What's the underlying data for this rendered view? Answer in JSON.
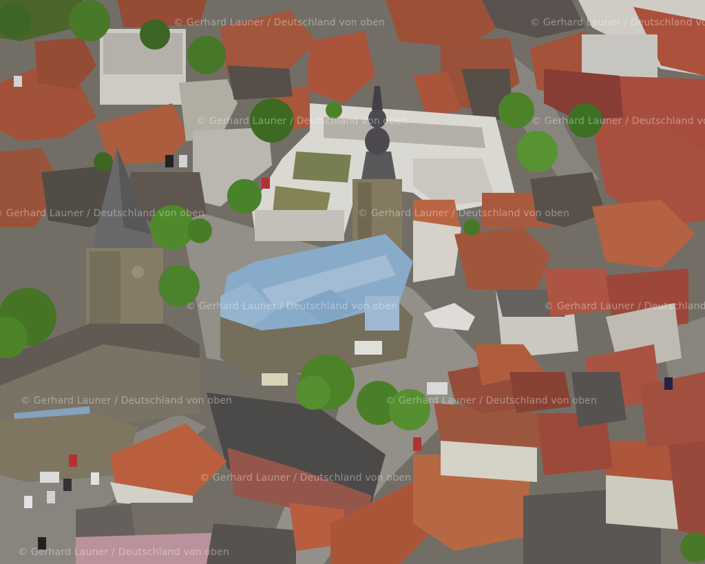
{
  "photo": {
    "subject": "aerial-view-old-town",
    "watermarks": [
      "© Gerhard Launer / Deutschland von oben",
      "© Gerhard Launer / Deutschland von oben",
      "© Gerhard Launer / Deutschland von oben",
      "© Gerhard Launer / Deutschland von oben",
      "© Gerhard Launer / Deutschland von oben",
      "© Gerhard Launer / Deutschland von oben",
      "© Gerhard Launer / Deutschland von oben",
      "© Gerhard Launer / Deutschland von oben",
      "© Gerhard Launer / Deutschland von oben",
      "© Gerhard Launer / Deutschland von oben",
      "© Gerhard Launer / Deutschland von oben",
      "© Gerhard Launer / Deutschland von oben"
    ],
    "colors": {
      "roof_red": "#b05a3c",
      "roof_dark": "#5e5650",
      "roof_blue": "#8fb4d4",
      "stone": "#7d7461",
      "tree": "#4f7d2c",
      "pavement": "#8c8a84"
    }
  }
}
